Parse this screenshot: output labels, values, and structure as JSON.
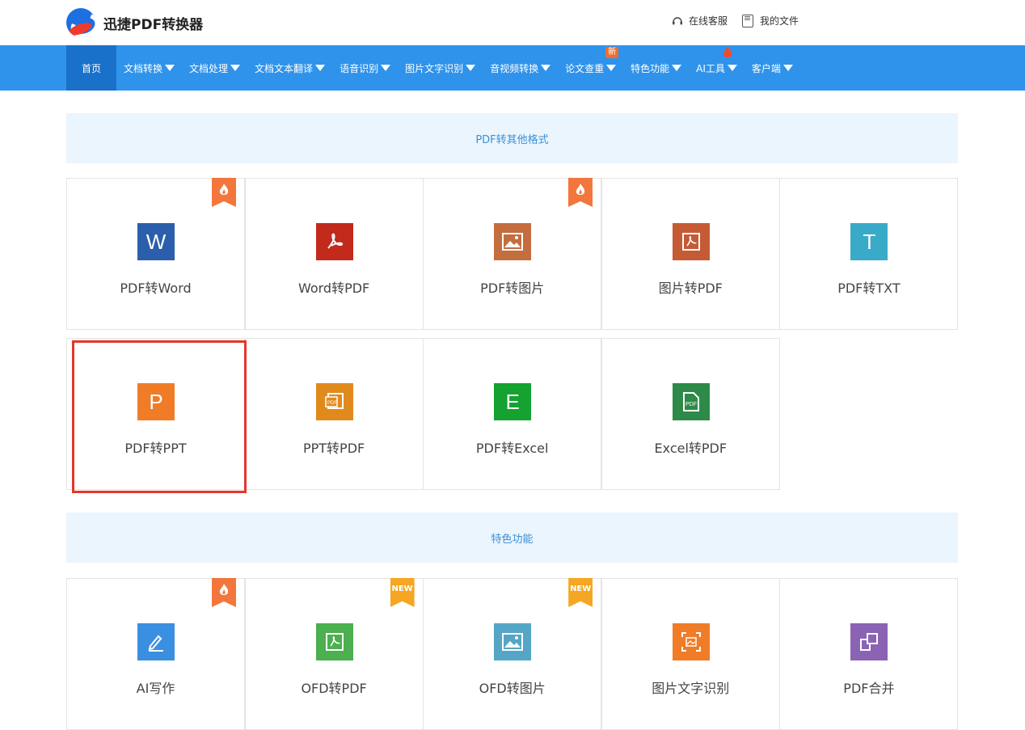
{
  "header": {
    "brand": "迅捷PDF转换器",
    "service": "在线客服",
    "files": "我的文件"
  },
  "nav": {
    "items": [
      {
        "label": "首页"
      },
      {
        "label": "文档转换"
      },
      {
        "label": "文档处理"
      },
      {
        "label": "文档文本翻译"
      },
      {
        "label": "语音识别"
      },
      {
        "label": "图片文字识别"
      },
      {
        "label": "音视频转换"
      },
      {
        "label": "论文查重",
        "badge": "新"
      },
      {
        "label": "特色功能"
      },
      {
        "label": "AI工具"
      },
      {
        "label": "客户端"
      }
    ]
  },
  "sections": {
    "pdf_other": "PDF转其他格式",
    "featured": "特色功能"
  },
  "cards_pdf": [
    {
      "label": "PDF转Word",
      "icon": "word-icon",
      "icon_char": "W",
      "color": "#2b5eab",
      "tag": "hot"
    },
    {
      "label": "Word转PDF",
      "icon": "pdf-icon",
      "color": "#c22a1b",
      "tag": ""
    },
    {
      "label": "PDF转图片",
      "icon": "image-icon",
      "color": "#c46d3f",
      "tag": "hot"
    },
    {
      "label": "图片转PDF",
      "icon": "pdf-file-icon",
      "color": "#c55b35",
      "tag": ""
    },
    {
      "label": "PDF转TXT",
      "icon": "txt-icon",
      "icon_char": "T",
      "color": "#3aaac9",
      "tag": ""
    },
    {
      "label": "PDF转PPT",
      "icon": "ppt-icon",
      "icon_char": "P",
      "color": "#f07c28",
      "tag": ""
    },
    {
      "label": "PPT转PDF",
      "icon": "ppt-pdf-icon",
      "color": "#e08a1c",
      "tag": ""
    },
    {
      "label": "PDF转Excel",
      "icon": "excel-icon",
      "icon_char": "E",
      "color": "#15a230",
      "tag": ""
    },
    {
      "label": "Excel转PDF",
      "icon": "excel-pdf-icon",
      "color": "#2e8a48",
      "tag": ""
    }
  ],
  "cards_featured": [
    {
      "label": "AI写作",
      "icon": "pencil-icon",
      "color": "#3b8fe0",
      "tag": "hot"
    },
    {
      "label": "OFD转PDF",
      "icon": "ofd-pdf-icon",
      "color": "#4caf50",
      "tag": "NEW"
    },
    {
      "label": "OFD转图片",
      "icon": "ofd-image-icon",
      "color": "#55a6c6",
      "tag": "NEW"
    },
    {
      "label": "图片文字识别",
      "icon": "ocr-icon",
      "color": "#f07c28",
      "tag": ""
    },
    {
      "label": "PDF合并",
      "icon": "merge-icon",
      "color": "#8a63b5",
      "tag": ""
    }
  ]
}
